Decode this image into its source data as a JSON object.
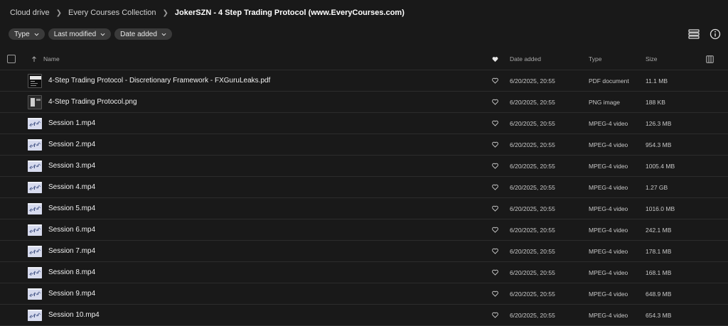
{
  "breadcrumb": {
    "items": [
      "Cloud drive",
      "Every Courses Collection"
    ],
    "current": "JokerSZN - 4 Step Trading Protocol (www.EveryCourses.com)"
  },
  "filters": [
    {
      "label": "Type"
    },
    {
      "label": "Last modified"
    },
    {
      "label": "Date added"
    }
  ],
  "top_icons": [
    "list-view-icon",
    "info-icon"
  ],
  "columns": {
    "name": "Name",
    "date_added": "Date added",
    "type": "Type",
    "size": "Size"
  },
  "files": [
    {
      "name": "4-Step Trading Protocol - Discretionary Framework - FXGuruLeaks.pdf",
      "date": "6/20/2025, 20:55",
      "type": "PDF document",
      "size": "11.1 MB",
      "thumb": "pdf"
    },
    {
      "name": "4-Step Trading Protocol.png",
      "date": "6/20/2025, 20:55",
      "type": "PNG image",
      "size": "188 KB",
      "thumb": "png"
    },
    {
      "name": "Session 1.mp4",
      "date": "6/20/2025, 20:55",
      "type": "MPEG-4 video",
      "size": "126.3 MB",
      "thumb": "video"
    },
    {
      "name": "Session 2.mp4",
      "date": "6/20/2025, 20:55",
      "type": "MPEG-4 video",
      "size": "954.3 MB",
      "thumb": "video"
    },
    {
      "name": "Session 3.mp4",
      "date": "6/20/2025, 20:55",
      "type": "MPEG-4 video",
      "size": "1005.4 MB",
      "thumb": "video"
    },
    {
      "name": "Session 4.mp4",
      "date": "6/20/2025, 20:55",
      "type": "MPEG-4 video",
      "size": "1.27 GB",
      "thumb": "video"
    },
    {
      "name": "Session 5.mp4",
      "date": "6/20/2025, 20:55",
      "type": "MPEG-4 video",
      "size": "1016.0 MB",
      "thumb": "video"
    },
    {
      "name": "Session 6.mp4",
      "date": "6/20/2025, 20:55",
      "type": "MPEG-4 video",
      "size": "242.1 MB",
      "thumb": "video"
    },
    {
      "name": "Session 7.mp4",
      "date": "6/20/2025, 20:55",
      "type": "MPEG-4 video",
      "size": "178.1 MB",
      "thumb": "video"
    },
    {
      "name": "Session 8.mp4",
      "date": "6/20/2025, 20:55",
      "type": "MPEG-4 video",
      "size": "168.1 MB",
      "thumb": "video"
    },
    {
      "name": "Session 9.mp4",
      "date": "6/20/2025, 20:55",
      "type": "MPEG-4 video",
      "size": "648.9 MB",
      "thumb": "video"
    },
    {
      "name": "Session 10.mp4",
      "date": "6/20/2025, 20:55",
      "type": "MPEG-4 video",
      "size": "654.3 MB",
      "thumb": "video"
    }
  ],
  "colors": {
    "background": "#191919",
    "chip": "#3a3a3a",
    "divider": "#2c2c2c"
  }
}
